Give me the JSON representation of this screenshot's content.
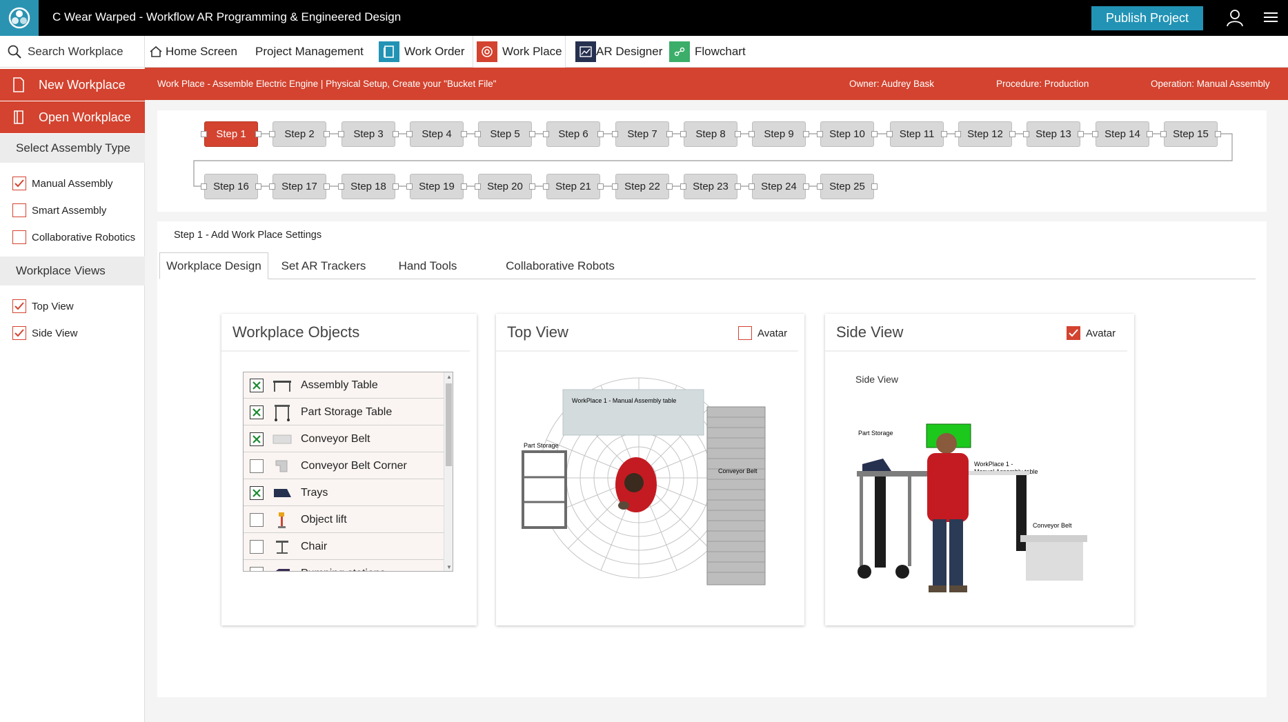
{
  "app": {
    "title": "C Wear Warped - Workflow AR Programming & Engineered Design",
    "publish_label": "Publish Project"
  },
  "nav": {
    "search_label": "Search Workplace",
    "tabs": [
      {
        "label": "Home Screen"
      },
      {
        "label": "Project Management"
      },
      {
        "label": "Work Order"
      },
      {
        "label": "Work Place"
      },
      {
        "label": "AR Designer"
      },
      {
        "label": "Flowchart"
      }
    ]
  },
  "sidebar": {
    "new_label": "New Workplace",
    "open_label": "Open Workplace",
    "assembly_header": "Select Assembly Type",
    "assembly_types": [
      {
        "label": "Manual Assembly",
        "checked": true
      },
      {
        "label": "Smart Assembly",
        "checked": false
      },
      {
        "label": "Collaborative Robotics",
        "checked": false
      }
    ],
    "views_header": "Workplace Views",
    "views": [
      {
        "label": "Top View",
        "checked": true
      },
      {
        "label": "Side View",
        "checked": true
      }
    ]
  },
  "infobar": {
    "title": "Work Place - Assemble Electric Engine | Physical Setup, Create your \"Bucket File\"",
    "owner": "Owner: Audrey Bask",
    "procedure": "Procedure: Production",
    "operation": "Operation: Manual Assembly"
  },
  "steps": [
    "Step 1",
    "Step 2",
    "Step 3",
    "Step 4",
    "Step 5",
    "Step 6",
    "Step 7",
    "Step 8",
    "Step 9",
    "Step 10",
    "Step 11",
    "Step 12",
    "Step 13",
    "Step 14",
    "Step 15",
    "Step 16",
    "Step 17",
    "Step 18",
    "Step 19",
    "Step 20",
    "Step 21",
    "Step 22",
    "Step 23",
    "Step 24",
    "Step 25"
  ],
  "active_step": "Step 1",
  "main": {
    "step_title": "Step 1 - Add Work Place Settings",
    "tabs": [
      "Workplace Design",
      "Set AR Trackers",
      "Hand Tools",
      "Collaborative Robots"
    ]
  },
  "objects_card": {
    "title": "Workplace Objects",
    "items": [
      {
        "label": "Assembly Table",
        "checked": true,
        "icon": "table-icon"
      },
      {
        "label": "Part Storage Table",
        "checked": true,
        "icon": "storage-table-icon"
      },
      {
        "label": "Conveyor Belt",
        "checked": true,
        "icon": "conveyor-icon"
      },
      {
        "label": "Conveyor Belt Corner",
        "checked": false,
        "icon": "conveyor-corner-icon"
      },
      {
        "label": "Trays",
        "checked": true,
        "icon": "tray-icon"
      },
      {
        "label": "Object lift",
        "checked": false,
        "icon": "lift-icon"
      },
      {
        "label": "Chair",
        "checked": false,
        "icon": "chair-icon"
      },
      {
        "label": "Pumping stations",
        "checked": false,
        "icon": "pump-icon"
      }
    ]
  },
  "top_card": {
    "title": "Top View",
    "avatar_label": "Avatar",
    "avatar_checked": false,
    "labels": {
      "table": "WorkPlace 1 - Manual Assembly table",
      "storage": "Part Storage",
      "conveyor": "Conveyor Belt"
    }
  },
  "side_card": {
    "title": "Side View",
    "avatar_label": "Avatar",
    "avatar_checked": true,
    "subtitle": "Side View",
    "labels": {
      "storage": "Part Storage",
      "table_1": "WorkPlace 1 -",
      "table_2": "Manual Assembly table",
      "conveyor": "Conveyor Belt"
    }
  },
  "colors": {
    "accent": "#d3432f",
    "publish": "#2293b5",
    "check_green": "#1a8a2e"
  }
}
